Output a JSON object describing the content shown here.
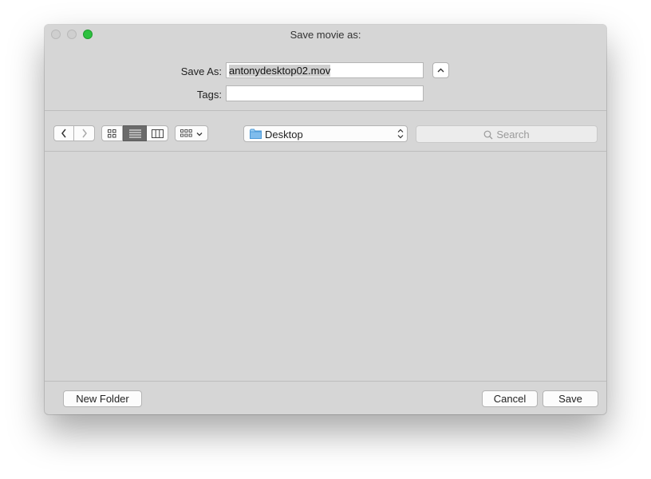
{
  "window": {
    "title": "Save movie as:"
  },
  "form": {
    "save_as_label": "Save As:",
    "save_as_value": "antonydesktop02.mov",
    "tags_label": "Tags:",
    "tags_value": ""
  },
  "toolbar": {
    "back_icon": "chevron-left-icon",
    "forward_icon": "chevron-right-icon",
    "view_modes": [
      "icon-view",
      "list-view",
      "column-view"
    ],
    "active_view": "list-view",
    "location": "Desktop",
    "search_placeholder": "Search"
  },
  "footer": {
    "new_folder_label": "New Folder",
    "cancel_label": "Cancel",
    "save_label": "Save"
  },
  "colors": {
    "window_bg": "#d6d6d6",
    "zoom_light": "#2dc13f",
    "active_segment": "#6b6b6b",
    "folder_icon": "#5aa9e6"
  }
}
